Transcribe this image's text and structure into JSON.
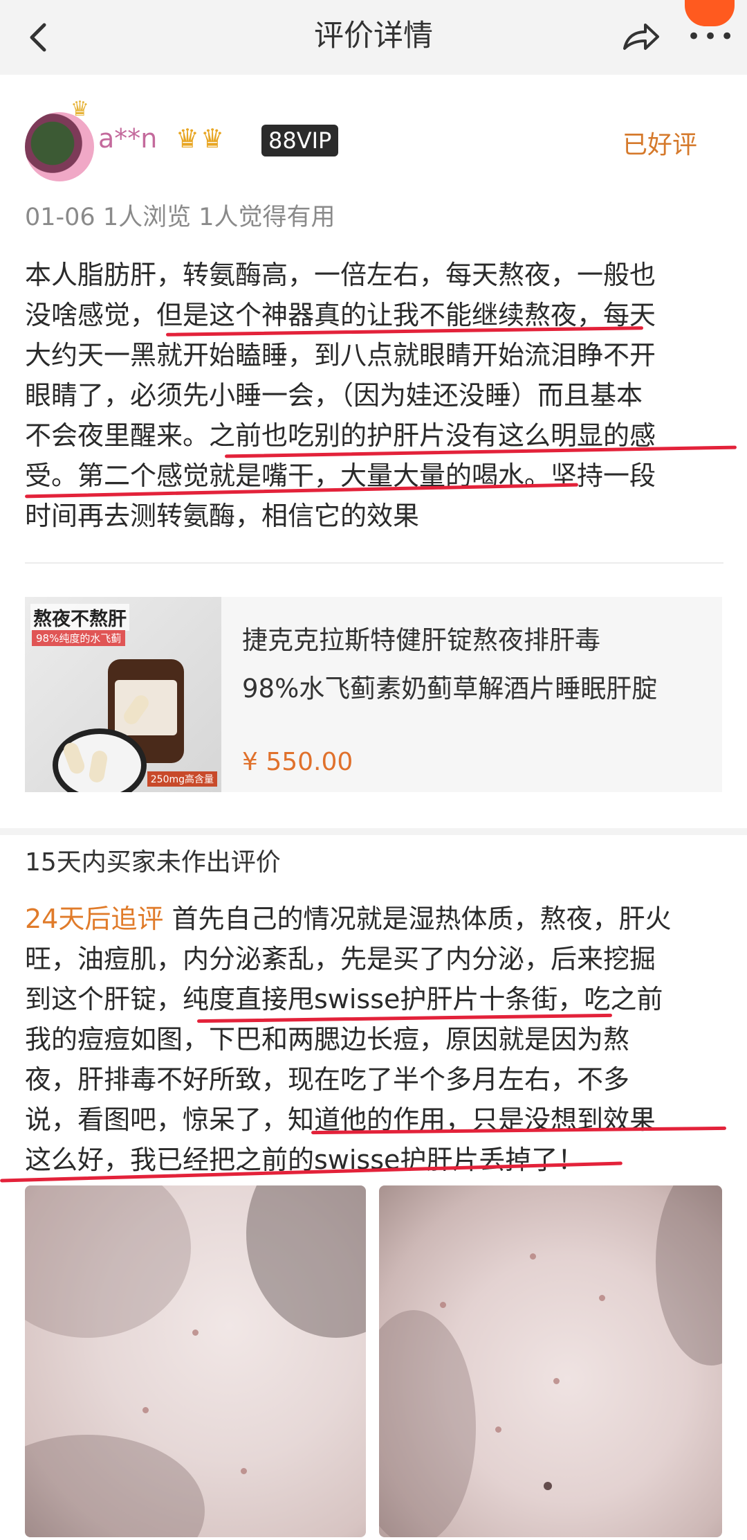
{
  "header": {
    "title": "评价详情",
    "back_icon": "back-arrow-icon",
    "share_icon": "share-icon",
    "more_label": "•••"
  },
  "review": {
    "username": "a**n",
    "crown_badges": "♛♛",
    "vip_badge": "88VIP",
    "status": "已好评",
    "meta": "01-06  1人浏览  1人觉得有用",
    "body_lines": [
      "本人脂肪肝，转氨酶高，一倍左右，每天熬夜，一般也",
      "没啥感觉，但是这个神器真的让我不能继续熬夜，每天",
      "大约天一黑就开始瞌睡，到八点就眼睛开始流泪睁不开",
      "眼睛了，必须先小睡一会，（因为娃还没睡）而且基本",
      "不会夜里醒来。之前也吃别的护肝片没有这么明显的感",
      "受。第二个感觉就是嘴干，大量大量的喝水。坚持一段",
      "时间再去测转氨酶，相信它的效果"
    ]
  },
  "product": {
    "thumb_badge": "熬夜不熬肝",
    "thumb_sub": "98%纯度的水飞蓟",
    "thumb_tag": "250mg高含量",
    "name_line1": "捷克克拉斯特健肝锭熬夜排肝毒",
    "name_line2": "98%水飞蓟素奶蓟草解酒片睡眠肝腚",
    "price": "¥ 550.00"
  },
  "no_review_note": "15天内买家未作出评价",
  "followup": {
    "tag": "24天后追评",
    "first_line_rest": " 首先自己的情况就是湿热体质，熬夜，肝火",
    "lines": [
      "旺，油痘肌，内分泌紊乱，先是买了内分泌，后来挖掘",
      "到这个肝锭，纯度直接甩swisse护肝片十条街，吃之前",
      "我的痘痘如图，下巴和两腮边长痘，原因就是因为熬",
      "夜，肝排毒不好所致，现在吃了半个多月左右，不多",
      "说，看图吧，惊呆了，知道他的作用，只是没想到效果",
      "这么好，我已经把之前的swisse护肝片丢掉了！"
    ]
  },
  "photos": {
    "left_label": "skin-photo-1",
    "right_label": "skin-photo-2"
  }
}
